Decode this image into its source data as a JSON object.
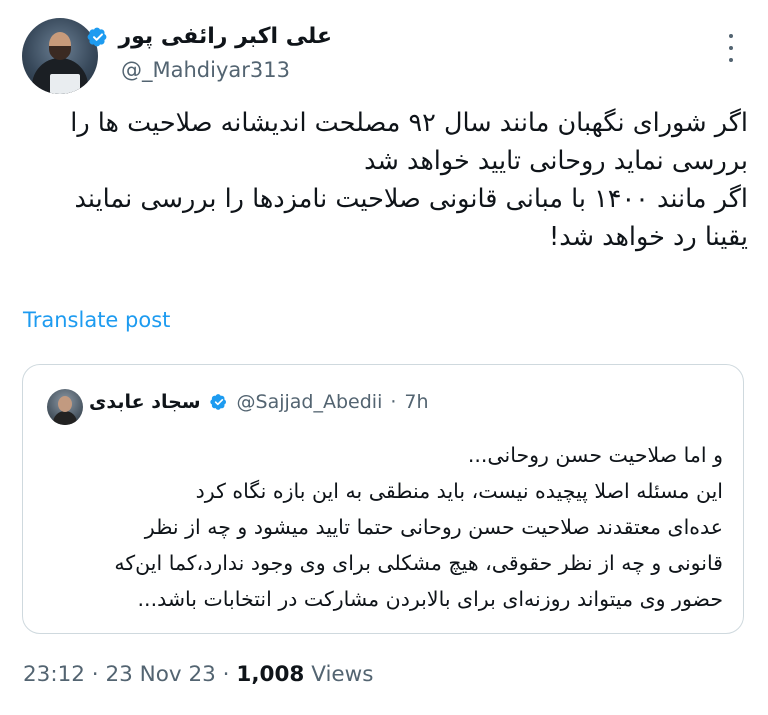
{
  "author": {
    "name": "علی اکبر رائفی پور",
    "handle": "@_Mahdiyar313"
  },
  "tweet": {
    "text": "اگر شورای نگهبان مانند سال ۹۲ مصلحت اندیشانه صلاحیت ها را\nبررسی نماید روحانی تایید خواهد شد\nاگر مانند ۱۴۰۰ با مبانی قانونی صلاحیت نامزدها را بررسی نمایند\nیقینا رد خواهد شد!",
    "translate_label": "Translate post"
  },
  "quoted": {
    "name": "سجاد عابدی",
    "handle": "@Sajjad_Abedii",
    "separator": "·",
    "time": "7h",
    "text": "و اما صلاحیت حسن روحانی...\nاین مسئله اصلا پیچیده نیست، باید منطقی به این بازه نگاه کرد\nعده‌ای معتقدند صلاحیت حسن روحانی حتما تایید میشود و چه از نظر\nقانونی و چه از نظر حقوقی، هیچ مشکلی برای وی وجود ندارد،کما این‌که\nحضور وی میتواند روزنه‌ای برای بالابردن مشارکت در انتخابات باشد..."
  },
  "meta": {
    "time": "23:12",
    "sep1": " · ",
    "date": "23 Nov 23",
    "sep2": " · ",
    "views_count": "1,008",
    "views_label": " Views"
  },
  "colors": {
    "verified": "#1d9bf0",
    "link": "#1d9bf0",
    "secondary_text": "#536471"
  },
  "icons": {
    "verified": "verified-badge-icon",
    "more": "more-options-icon"
  }
}
